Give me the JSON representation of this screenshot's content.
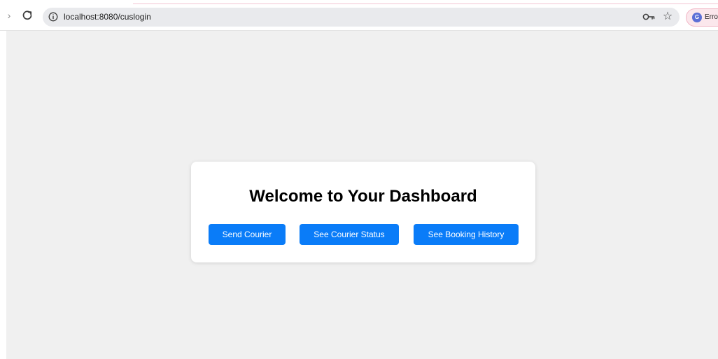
{
  "browser": {
    "url": "localhost:8080/cuslogin",
    "profile_initial": "G",
    "profile_label": "Erro",
    "colors": {
      "accent_line": "#f3c6d4",
      "omnibox_bg": "#e9eaed",
      "profile_chip_bg": "#fbe7ec",
      "avatar_bg": "#5b6fd6"
    },
    "icons": [
      "forward-arrow-icon",
      "reload-icon",
      "info-icon",
      "key-icon",
      "star-icon"
    ]
  },
  "page": {
    "background": "#f0f0f0",
    "card": {
      "title": "Welcome to Your Dashboard",
      "buttons": {
        "send_courier": "Send Courier",
        "see_courier_status": "See Courier Status",
        "see_booking_history": "See Booking History"
      },
      "button_color": "#0a7cf8"
    }
  }
}
